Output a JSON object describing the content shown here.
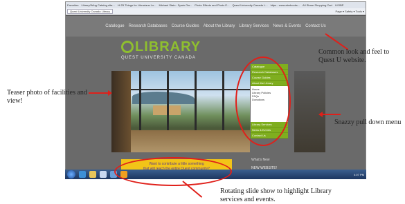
{
  "browser": {
    "favorites_items": [
      "Favorites",
      "Library/Wing Catalog.ulta...",
      "Hi 25 Things for Librarians Lo...",
      "Michael Stain : Spain Ow...",
      "Photo Effects and Photo E...",
      "Quest University Canada L...",
      "https - www.abebooks...",
      "All Share Shopping Cart",
      "U/OBP"
    ],
    "tab_title": "Quest University Canada Library",
    "toolbar_text": "Page ▾  Safety ▾  Tools ▾"
  },
  "site": {
    "nav": [
      "Catalogue",
      "Research Databases",
      "Course Guides",
      "About the Library",
      "Library Services",
      "News & Events",
      "Contact Us"
    ],
    "logo_word": "LIBRARY",
    "logo_sub": "QUEST UNIVERSITY CANADA",
    "menu_top": [
      "Catalogue",
      "Research Databases",
      "Course Guides",
      "About the Library"
    ],
    "menu_sub": [
      "Hours",
      "Library Policies",
      "FAQs",
      "Donations"
    ],
    "menu_bottom": [
      "Library Services",
      "News & Events",
      "Contact Us"
    ],
    "whats_new": "What's New",
    "new_website": "NEW WEBSITE!",
    "new_website_sub": "Take some time to explore.",
    "banner_line1": "Want to contribute a little something",
    "banner_line2": "that will reach the entire Quest community?"
  },
  "status": {
    "left": "Done",
    "right": "Local intranet | Protected Mode: Off",
    "zoom": "100%"
  },
  "taskbar": {
    "clock": "4:07 PM"
  },
  "callouts": {
    "top_right": "Common look and feel to Quest U website.",
    "left": "Teaser photo of facilities and view!",
    "right": "Snazzy pull down menu",
    "bottom": "Rotating slide show to highlight Library services and events."
  },
  "colors": {
    "brand_green": "#8fbf2f",
    "menu_green": "#7fae1f",
    "banner_yellow": "#f2c418",
    "annotation_red": "#e0201a"
  }
}
